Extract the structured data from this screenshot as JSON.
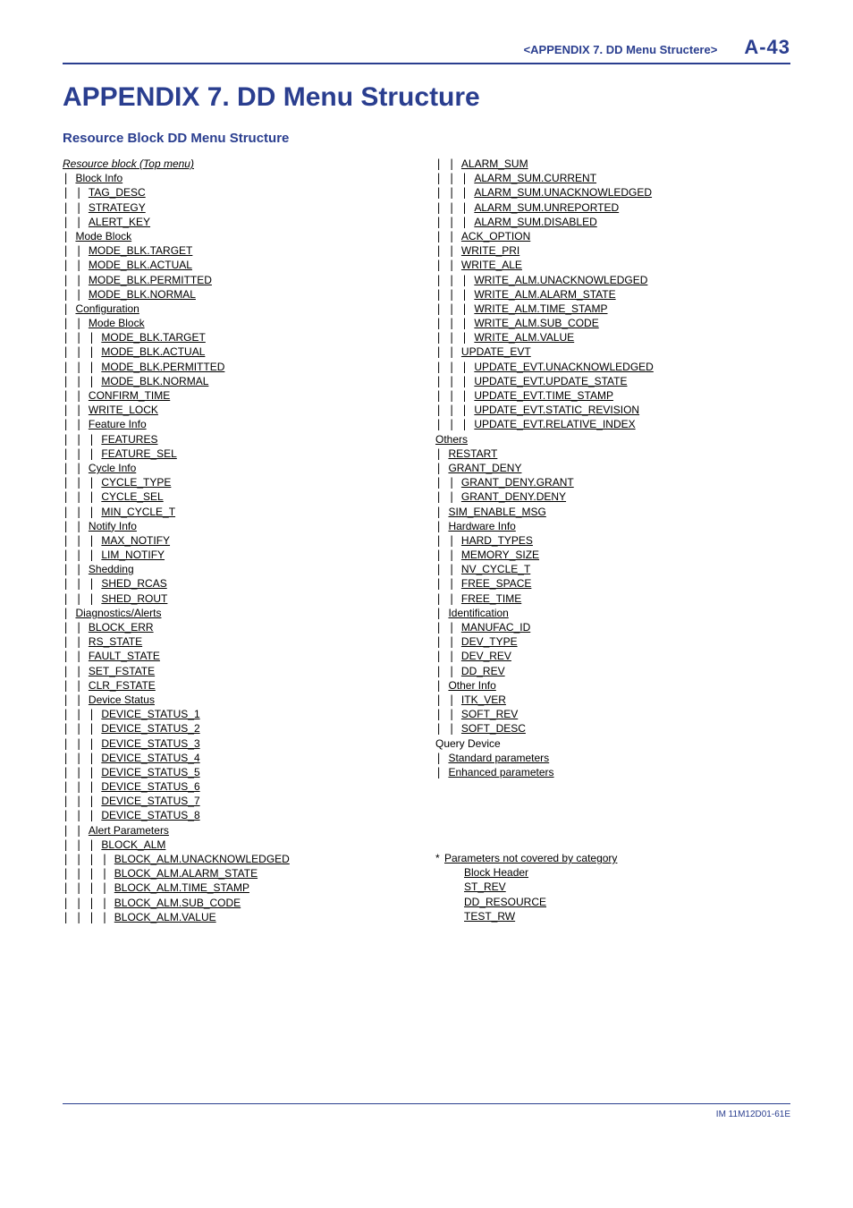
{
  "header": {
    "breadcrumb": "<APPENDIX 7. DD Menu Structere>",
    "page": "A-43"
  },
  "title": "APPENDIX 7. DD Menu Structure",
  "subtitle": "Resource Block DD Menu Structure",
  "footer": "IM 11M12D01-61E",
  "col1": [
    {
      "d": 0,
      "l": "Resource block (Top menu)",
      "i": true
    },
    {
      "d": 1,
      "l": "Block Info"
    },
    {
      "d": 2,
      "l": "TAG_DESC"
    },
    {
      "d": 2,
      "l": "STRATEGY"
    },
    {
      "d": 2,
      "l": "ALERT_KEY"
    },
    {
      "d": 1,
      "l": "Mode Block"
    },
    {
      "d": 2,
      "l": "MODE_BLK.TARGET"
    },
    {
      "d": 2,
      "l": "MODE_BLK.ACTUAL"
    },
    {
      "d": 2,
      "l": "MODE_BLK.PERMITTED"
    },
    {
      "d": 2,
      "l": "MODE_BLK.NORMAL"
    },
    {
      "d": 1,
      "l": "Configuration"
    },
    {
      "d": 2,
      "l": "Mode Block"
    },
    {
      "d": 3,
      "l": "MODE_BLK.TARGET"
    },
    {
      "d": 3,
      "l": "MODE_BLK.ACTUAL"
    },
    {
      "d": 3,
      "l": "MODE_BLK.PERMITTED"
    },
    {
      "d": 3,
      "l": "MODE_BLK.NORMAL"
    },
    {
      "d": 2,
      "l": "CONFIRM_TIME"
    },
    {
      "d": 2,
      "l": "WRITE_LOCK"
    },
    {
      "d": 2,
      "l": "Feature Info"
    },
    {
      "d": 3,
      "l": "FEATURES"
    },
    {
      "d": 3,
      "l": "FEATURE_SEL"
    },
    {
      "d": 2,
      "l": "Cycle Info"
    },
    {
      "d": 3,
      "l": "CYCLE_TYPE"
    },
    {
      "d": 3,
      "l": "CYCLE_SEL"
    },
    {
      "d": 3,
      "l": "MIN_CYCLE_T"
    },
    {
      "d": 2,
      "l": "Notify Info"
    },
    {
      "d": 3,
      "l": "MAX_NOTIFY"
    },
    {
      "d": 3,
      "l": "LIM_NOTIFY"
    },
    {
      "d": 2,
      "l": "Shedding"
    },
    {
      "d": 3,
      "l": "SHED_RCAS"
    },
    {
      "d": 3,
      "l": "SHED_ROUT"
    },
    {
      "d": 1,
      "l": "Diagnostics/Alerts"
    },
    {
      "d": 2,
      "l": "BLOCK_ERR"
    },
    {
      "d": 2,
      "l": "RS_STATE"
    },
    {
      "d": 2,
      "l": "FAULT_STATE"
    },
    {
      "d": 2,
      "l": "SET_FSTATE"
    },
    {
      "d": 2,
      "l": "CLR_FSTATE"
    },
    {
      "d": 2,
      "l": "Device Status"
    },
    {
      "d": 3,
      "l": "DEVICE_STATUS_1"
    },
    {
      "d": 3,
      "l": "DEVICE_STATUS_2"
    },
    {
      "d": 3,
      "l": "DEVICE_STATUS_3"
    },
    {
      "d": 3,
      "l": "DEVICE_STATUS_4"
    },
    {
      "d": 3,
      "l": "DEVICE_STATUS_5"
    },
    {
      "d": 3,
      "l": "DEVICE_STATUS_6"
    },
    {
      "d": 3,
      "l": "DEVICE_STATUS_7"
    },
    {
      "d": 3,
      "l": "DEVICE_STATUS_8"
    },
    {
      "d": 2,
      "l": "Alert Parameters"
    },
    {
      "d": 3,
      "l": "BLOCK_ALM"
    },
    {
      "d": 4,
      "l": "BLOCK_ALM.UNACKNOWLEDGED"
    },
    {
      "d": 4,
      "l": "BLOCK_ALM.ALARM_STATE"
    },
    {
      "d": 4,
      "l": "BLOCK_ALM.TIME_STAMP"
    },
    {
      "d": 4,
      "l": "BLOCK_ALM.SUB_CODE"
    },
    {
      "d": 4,
      "l": "BLOCK_ALM.VALUE"
    }
  ],
  "col2": [
    {
      "d": 3,
      "l": "ALARM_SUM"
    },
    {
      "d": 4,
      "l": "ALARM_SUM.CURRENT"
    },
    {
      "d": 4,
      "l": "ALARM_SUM.UNACKNOWLEDGED"
    },
    {
      "d": 4,
      "l": "ALARM_SUM.UNREPORTED"
    },
    {
      "d": 4,
      "l": "ALARM_SUM.DISABLED"
    },
    {
      "d": 3,
      "l": "ACK_OPTION"
    },
    {
      "d": 3,
      "l": "WRITE_PRI"
    },
    {
      "d": 3,
      "l": "WRITE_ALE"
    },
    {
      "d": 4,
      "l": "WRITE_ALM.UNACKNOWLEDGED"
    },
    {
      "d": 4,
      "l": "WRITE_ALM.ALARM_STATE"
    },
    {
      "d": 4,
      "l": "WRITE_ALM.TIME_STAMP"
    },
    {
      "d": 4,
      "l": "WRITE_ALM.SUB_CODE"
    },
    {
      "d": 4,
      "l": "WRITE_ALM.VALUE"
    },
    {
      "d": 3,
      "l": "UPDATE_EVT"
    },
    {
      "d": 4,
      "l": "UPDATE_EVT.UNACKNOWLEDGED"
    },
    {
      "d": 4,
      "l": "UPDATE_EVT.UPDATE_STATE"
    },
    {
      "d": 4,
      "l": "UPDATE_EVT.TIME_STAMP"
    },
    {
      "d": 4,
      "l": "UPDATE_EVT.STATIC_REVISION"
    },
    {
      "d": 4,
      "l": "UPDATE_EVT.RELATIVE_INDEX"
    },
    {
      "d": 1,
      "l": "Others"
    },
    {
      "d": 2,
      "l": "RESTART"
    },
    {
      "d": 2,
      "l": "GRANT_DENY"
    },
    {
      "d": 3,
      "l": "GRANT_DENY.GRANT"
    },
    {
      "d": 3,
      "l": "GRANT_DENY.DENY"
    },
    {
      "d": 2,
      "l": "SIM_ENABLE_MSG"
    },
    {
      "d": 2,
      "l": "Hardware Info"
    },
    {
      "d": 3,
      "l": "HARD_TYPES"
    },
    {
      "d": 3,
      "l": "MEMORY_SIZE"
    },
    {
      "d": 3,
      "l": "NV_CYCLE_T"
    },
    {
      "d": 3,
      "l": "FREE_SPACE"
    },
    {
      "d": 3,
      "l": "FREE_TIME"
    },
    {
      "d": 2,
      "l": "Identification"
    },
    {
      "d": 3,
      "l": "MANUFAC_ID"
    },
    {
      "d": 3,
      "l": "DEV_TYPE"
    },
    {
      "d": 3,
      "l": "DEV_REV"
    },
    {
      "d": 3,
      "l": "DD_REV"
    },
    {
      "d": 2,
      "l": "Other Info"
    },
    {
      "d": 3,
      "l": "ITK_VER"
    },
    {
      "d": 3,
      "l": "SOFT_REV"
    },
    {
      "d": 3,
      "l": "SOFT_DESC"
    },
    {
      "d": 1,
      "l": "Query Device",
      "u": false
    },
    {
      "d": 2,
      "l": "Standard parameters"
    },
    {
      "d": 2,
      "l": "Enhanced parameters"
    }
  ],
  "note": {
    "heading": "Parameters not covered by category",
    "items": [
      "Block Header",
      "ST_REV",
      "DD_RESOURCE",
      "TEST_RW"
    ]
  }
}
